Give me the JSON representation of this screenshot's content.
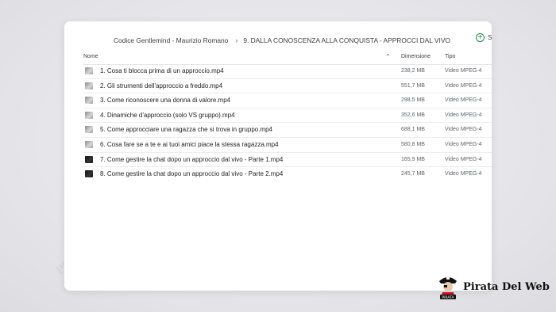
{
  "breadcrumb": {
    "parent": "Codice Gentlemind - Maurizio Romano",
    "current": "9. DALLA CONOSCENZA ALLA CONQUISTA - APPROCCI DAL VIVO"
  },
  "actions": {
    "add_label": "S"
  },
  "columns": {
    "name": "Nome",
    "size": "Dimensione",
    "type": "Tipo"
  },
  "files": [
    {
      "name": "1. Cosa ti blocca prima di un approccio.mp4",
      "size": "238,2 MB",
      "type": "Video MPEG-4",
      "thumb": "light"
    },
    {
      "name": "2. Gli strumenti dell'approccio a freddo.mp4",
      "size": "551,7 MB",
      "type": "Video MPEG-4",
      "thumb": "light"
    },
    {
      "name": "3. Come riconoscere una donna di valore.mp4",
      "size": "298,5 MB",
      "type": "Video MPEG-4",
      "thumb": "light"
    },
    {
      "name": "4. Dinamiche d'approccio (solo VS gruppo).mp4",
      "size": "352,6 MB",
      "type": "Video MPEG-4",
      "thumb": "light"
    },
    {
      "name": "5. Come approcciare una ragazza che si trova in gruppo.mp4",
      "size": "688,1 MB",
      "type": "Video MPEG-4",
      "thumb": "light"
    },
    {
      "name": "6. Cosa fare se a te e ai tuoi amici piace la stessa ragazza.mp4",
      "size": "580,8 MB",
      "type": "Video MPEG-4",
      "thumb": "light"
    },
    {
      "name": "7. Come gestire la chat dopo un approccio dal vivo - Parte 1.mp4",
      "size": "165,9 MB",
      "type": "Video MPEG-4",
      "thumb": "dark"
    },
    {
      "name": "8. Come gestire la chat dopo un approccio dal vivo - Parte 2.mp4",
      "size": "245,7 MB",
      "type": "Video MPEG-4",
      "thumb": "dark"
    }
  ],
  "watermark": {
    "text": "Pirata Del Web"
  },
  "brand": {
    "name": "Pirata Del Web",
    "badge": "PIRATA"
  },
  "colors": {
    "accent": "#1e8e3e",
    "background": "#e9e9ed",
    "window": "#ffffff"
  }
}
